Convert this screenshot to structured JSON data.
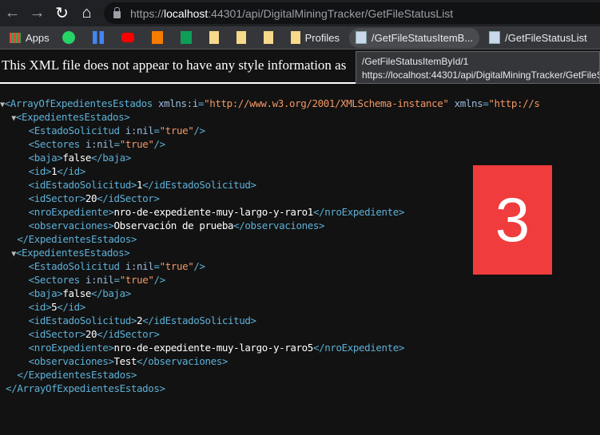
{
  "browser": {
    "url_prefix": "https://",
    "url_host": "localhost",
    "url_rest": ":44301/api/DigitalMiningTracker/GetFileStatusList"
  },
  "bookmarks": [
    {
      "label": "Apps",
      "icon": "apps-grid-icon"
    },
    {
      "label": "",
      "icon": "whatsapp-icon"
    },
    {
      "label": "",
      "icon": "blue-bars-icon"
    },
    {
      "label": "",
      "icon": "youtube-icon"
    },
    {
      "label": "",
      "icon": "info-icon"
    },
    {
      "label": "",
      "icon": "sheets-icon"
    },
    {
      "label": "",
      "icon": "folder-icon"
    },
    {
      "label": "",
      "icon": "folder-icon"
    },
    {
      "label": "",
      "icon": "folder-icon"
    },
    {
      "label": "Profiles",
      "icon": "folder-icon"
    },
    {
      "label": "/GetFileStatusItemB...",
      "icon": "page-icon"
    },
    {
      "label": "/GetFileStatusList",
      "icon": "page-icon"
    }
  ],
  "tooltip": {
    "title": "/GetFileStatusItemById/1",
    "url": "https://localhost:44301/api/DigitalMiningTracker/GetFileS"
  },
  "message": "This XML file does not appear to have any style information as",
  "badge": "3",
  "xml": [
    [
      0,
      true,
      [
        [
          "tag",
          "<ArrayOfExpedientesEstados "
        ],
        [
          "an",
          "xmlns:i"
        ],
        [
          "tag",
          "="
        ],
        [
          "av",
          "\"http://www.w3.org/2001/XMLSchema-instance\""
        ],
        [
          "an",
          " xmlns"
        ],
        [
          "tag",
          "="
        ],
        [
          "av",
          "\"http://s"
        ]
      ]
    ],
    [
      1,
      true,
      [
        [
          "tag",
          "<ExpedientesEstados>"
        ]
      ]
    ],
    [
      2,
      false,
      [
        [
          "tag",
          "<EstadoSolicitud "
        ],
        [
          "an",
          "i:nil"
        ],
        [
          "tag",
          "="
        ],
        [
          "av",
          "\"true\""
        ],
        [
          "tag",
          "/>"
        ]
      ]
    ],
    [
      2,
      false,
      [
        [
          "tag",
          "<Sectores "
        ],
        [
          "an",
          "i:nil"
        ],
        [
          "tag",
          "="
        ],
        [
          "av",
          "\"true\""
        ],
        [
          "tag",
          "/>"
        ]
      ]
    ],
    [
      2,
      false,
      [
        [
          "tag",
          "<baja>"
        ],
        [
          "tx",
          "false"
        ],
        [
          "tag",
          "</baja>"
        ]
      ]
    ],
    [
      2,
      false,
      [
        [
          "tag",
          "<id>"
        ],
        [
          "tx",
          "1"
        ],
        [
          "tag",
          "</id>"
        ]
      ]
    ],
    [
      2,
      false,
      [
        [
          "tag",
          "<idEstadoSolicitud>"
        ],
        [
          "tx",
          "1"
        ],
        [
          "tag",
          "</idEstadoSolicitud>"
        ]
      ]
    ],
    [
      2,
      false,
      [
        [
          "tag",
          "<idSector>"
        ],
        [
          "tx",
          "20"
        ],
        [
          "tag",
          "</idSector>"
        ]
      ]
    ],
    [
      2,
      false,
      [
        [
          "tag",
          "<nroExpediente>"
        ],
        [
          "tx",
          "nro-de-expediente-muy-largo-y-raro1"
        ],
        [
          "tag",
          "</nroExpediente>"
        ]
      ]
    ],
    [
      2,
      false,
      [
        [
          "tag",
          "<observaciones>"
        ],
        [
          "tx",
          "Observación de prueba"
        ],
        [
          "tag",
          "</observaciones>"
        ]
      ]
    ],
    [
      1,
      false,
      [
        [
          "tag",
          "</ExpedientesEstados>"
        ]
      ]
    ],
    [
      1,
      true,
      [
        [
          "tag",
          "<ExpedientesEstados>"
        ]
      ]
    ],
    [
      2,
      false,
      [
        [
          "tag",
          "<EstadoSolicitud "
        ],
        [
          "an",
          "i:nil"
        ],
        [
          "tag",
          "="
        ],
        [
          "av",
          "\"true\""
        ],
        [
          "tag",
          "/>"
        ]
      ]
    ],
    [
      2,
      false,
      [
        [
          "tag",
          "<Sectores "
        ],
        [
          "an",
          "i:nil"
        ],
        [
          "tag",
          "="
        ],
        [
          "av",
          "\"true\""
        ],
        [
          "tag",
          "/>"
        ]
      ]
    ],
    [
      2,
      false,
      [
        [
          "tag",
          "<baja>"
        ],
        [
          "tx",
          "false"
        ],
        [
          "tag",
          "</baja>"
        ]
      ]
    ],
    [
      2,
      false,
      [
        [
          "tag",
          "<id>"
        ],
        [
          "tx",
          "5"
        ],
        [
          "tag",
          "</id>"
        ]
      ]
    ],
    [
      2,
      false,
      [
        [
          "tag",
          "<idEstadoSolicitud>"
        ],
        [
          "tx",
          "2"
        ],
        [
          "tag",
          "</idEstadoSolicitud>"
        ]
      ]
    ],
    [
      2,
      false,
      [
        [
          "tag",
          "<idSector>"
        ],
        [
          "tx",
          "20"
        ],
        [
          "tag",
          "</idSector>"
        ]
      ]
    ],
    [
      2,
      false,
      [
        [
          "tag",
          "<nroExpediente>"
        ],
        [
          "tx",
          "nro-de-expediente-muy-largo-y-raro5"
        ],
        [
          "tag",
          "</nroExpediente>"
        ]
      ]
    ],
    [
      2,
      false,
      [
        [
          "tag",
          "<observaciones>"
        ],
        [
          "tx",
          "Test"
        ],
        [
          "tag",
          "</observaciones>"
        ]
      ]
    ],
    [
      1,
      false,
      [
        [
          "tag",
          "</ExpedientesEstados>"
        ]
      ]
    ],
    [
      0,
      false,
      [
        [
          "tag",
          "</ArrayOfExpedientesEstados>"
        ]
      ]
    ]
  ]
}
